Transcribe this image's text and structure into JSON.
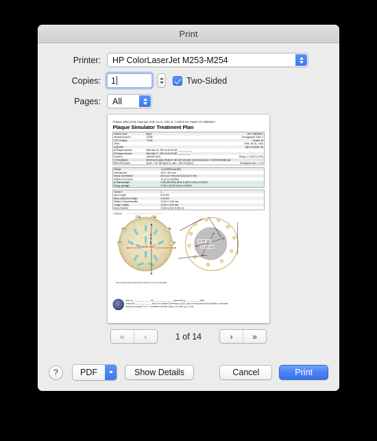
{
  "window": {
    "title": "Print"
  },
  "form": {
    "printer_label": "Printer:",
    "printer_value": "HP ColorLaserJet M253-M254",
    "copies_label": "Copies:",
    "copies_value": "1",
    "two_sided_label": "Two-Sided",
    "pages_label": "Pages:",
    "pages_value": "All"
  },
  "pager": {
    "first_label": "«",
    "prev_label": "‹",
    "next_label": "›",
    "last_label": "»",
    "page_count": "1 of 14"
  },
  "footer": {
    "help_label": "?",
    "pdf_label": "PDF",
    "show_details_label": "Show Details",
    "cancel_label": "Cancel",
    "print_label": "Print"
  },
  "colors": {
    "accent_blue": "#3c78ef",
    "print_button_blue": "#4c84f2",
    "window_background": "#ececec",
    "titlebar_background": "#d7d7d7",
    "seed_teal": "#6fd4d8",
    "dimension_red": "#c02a17",
    "measure_brown": "#7a2d18",
    "plaque_gold": "#c8a83d"
  },
  "preview": {
    "header_line": "Pt:Basic, MRN:12345, Right eye, DOB: Oct 31, 1952, M, T=168.00 hrs, PlanID:XXX-25B05AF1",
    "title": "Plaque Simulator Treatment Plan",
    "table1": [
      {
        "c1": "Patient name:",
        "c2": "Basic",
        "c3": "PID: 25B05AF1",
        "style": "alt"
      },
      {
        "c1": "Medical record #:",
        "c2": "12345",
        "c3": "Demographic code: 0",
        "style": "plain"
      },
      {
        "c1": "CPT Code(s):",
        "c2": "77263",
        "c3": "Gender: M",
        "style": "alt"
      },
      {
        "c1": "Other:",
        "c2": "",
        "c3": "DOB: Oct 31, 1952",
        "style": "plain"
      },
      {
        "c1": "Institution:",
        "c2": "",
        "c3": "Age at implant: 68",
        "style": "alt"
      },
      {
        "c1": "Plaque insertion:",
        "c2": "Wed Mar 10, 2021 at 10:00 AM ___________",
        "c3": "",
        "style": "plain",
        "bullet": "green"
      },
      {
        "c1": "Plaque removal:",
        "c2": "Wed Mar 17, 2021 at 11:00 AM ___________",
        "c3": "",
        "style": "alt",
        "bullet": "red"
      },
      {
        "c1": "Duration:",
        "c2": "168.000 hours",
        "c3": "Range: ± 3.36 hr (2.0%)",
        "style": "plain"
      },
      {
        "c1": "Prescription:",
        "c2": "85.00 Gy to apex of tumor 1 @ 6.00 mm (dist. from inner sclera = 6.00 mm)  Right eye",
        "c3": "",
        "style": "hl",
        "bullet": "orange"
      },
      {
        "c1": "BED at Rx point:",
        "c2": "Acute = 137.38 Gy(10.0), Late = 180.26 Gy(3.0)",
        "c3": "Therapeutic ratio = 0.76",
        "style": "plain"
      }
    ],
    "table2": [
      {
        "c1": "Plaque:",
        "c2": "1 (COMS16-sz) (Rx)",
        "c3": "",
        "style": "alt"
      },
      {
        "c1": "Nominal size:",
        "c2": "16.0 x 16.0 mm",
        "c3": "",
        "style": "plain"
      },
      {
        "c1": "Suture coordinates:",
        "c2": "(9/13,12.0 mm) and (11/16,12.0 mm)",
        "c3": "",
        "style": "alt"
      },
      {
        "c1": "Number of sources:",
        "c2": "13 (of 13 possible)",
        "c3": "",
        "style": "plain"
      },
      {
        "c1": "Total strength:",
        "c2": "I-125 (S#:1254) 48.42 U (38.12 mCi) on 3/10/21",
        "c3": "",
        "style": "hl",
        "bullet": "blue"
      },
      {
        "c1": "Avg. strength:",
        "c2": "3.724 U (2.933 mCi) on 3/10/21",
        "c3": "",
        "style": "hl",
        "bullet": "blue"
      }
    ],
    "table3": [
      {
        "c1": "Tumor #:",
        "c2": "1",
        "c3": "",
        "style": "alt"
      },
      {
        "c1": "Apex height:",
        "c2": "6.00 mm",
        "c3": "",
        "style": "plain"
      },
      {
        "c1": "Base expansion margin:",
        "c2": "2.00 mm",
        "c3": "",
        "style": "alt"
      },
      {
        "c1": "Radial x Circumferential:",
        "c2": "12.00 x 12.00 mm",
        "c3": "",
        "style": "plain"
      },
      {
        "c1": "Length x Width:",
        "c2": "12.00 x 12.00 mm",
        "c3": "",
        "style": "alt"
      },
      {
        "c1": "Area (Volume):",
        "c2": "123.8 sq.mm (0.451 cc)",
        "c3": "",
        "style": "plain"
      }
    ],
    "figure": {
      "plaque_label": "COMS16",
      "width_dimension": "16.00 mm",
      "height_dimension": "16.00 mm",
      "tumor_dimension_1": "12.00 mm",
      "tumor_dimension_2": "12.00 mm",
      "notch_labels": [
        "A1",
        "B1",
        "A2",
        "B2",
        "A3",
        "B3"
      ]
    },
    "footnote": "* See plaque loading instructions document for seed strengths.",
    "footer_lines": [
      "Plan by ______________ for ________________ approved by ___________ (MD)",
      "Institution ______________EULA:A:A:Italian.EyePhysics.2021.Login:minimalchitae:PSUser/Minor: Astrahan",
      "Plaque Simulator™ 6.7.7 12/18/20 2:23 PM, Page 1 (Tx Plan pg 1 of 5)"
    ]
  }
}
